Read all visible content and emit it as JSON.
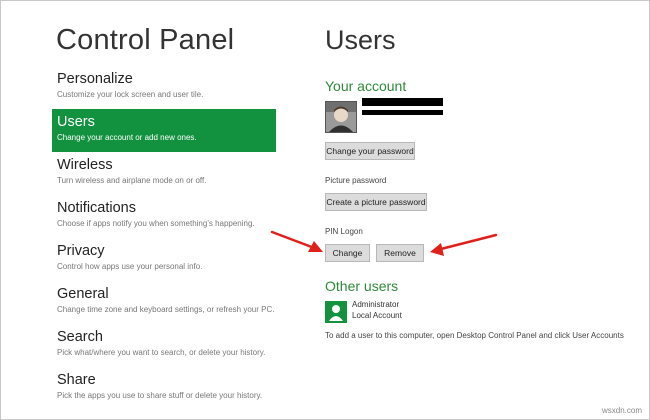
{
  "left": {
    "title": "Control Panel",
    "items": [
      {
        "name": "Personalize",
        "desc": "Customize your lock screen and user tile."
      },
      {
        "name": "Users",
        "desc": "Change your account or add new ones."
      },
      {
        "name": "Wireless",
        "desc": "Turn wireless and airplane mode on or off."
      },
      {
        "name": "Notifications",
        "desc": "Choose if apps notify you when something's happening."
      },
      {
        "name": "Privacy",
        "desc": "Control how apps use your personal info."
      },
      {
        "name": "General",
        "desc": "Change time zone and keyboard settings, or refresh your PC."
      },
      {
        "name": "Search",
        "desc": "Pick what/where you want to search, or delete your history."
      },
      {
        "name": "Share",
        "desc": "Pick the apps you use to share stuff or delete your history."
      }
    ],
    "active_index": 1
  },
  "right": {
    "title": "Users",
    "your_account": {
      "heading": "Your account",
      "change_password_label": "Change your password",
      "picture_password_label": "Picture password",
      "create_picture_password_label": "Create a picture password",
      "pin_logon_label": "PIN Logon",
      "change_label": "Change",
      "remove_label": "Remove"
    },
    "other_users": {
      "heading": "Other users",
      "user_name": "Administrator",
      "user_type": "Local Account",
      "note": "To add a user to this computer, open Desktop Control Panel and click User Accounts"
    }
  },
  "watermark": "wsxdn.com",
  "colors": {
    "accent": "#12913f",
    "heading_green": "#2e8a3a",
    "annotation_arrow": "#e0201b"
  }
}
